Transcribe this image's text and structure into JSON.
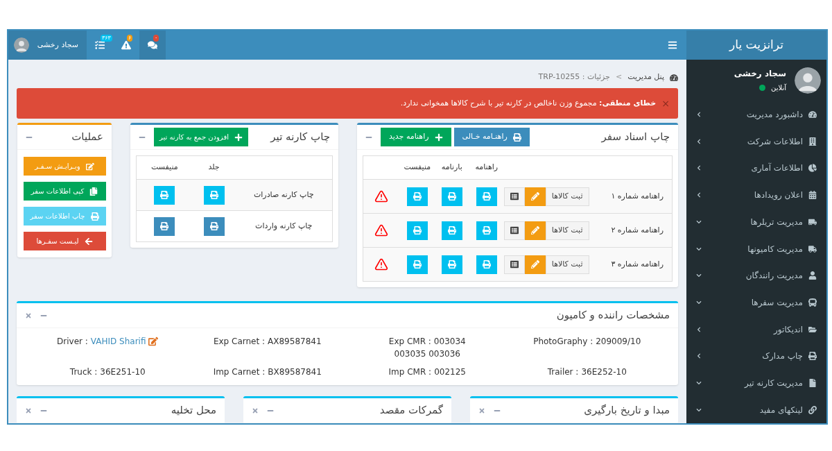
{
  "sidebar": {
    "brand": "ترانزیت یار",
    "user": {
      "name": "سجاد رخشی",
      "status": "آنلاین",
      "online": true
    },
    "items": [
      {
        "label": "داشبورد مدیریت",
        "expanded": false
      },
      {
        "label": "اطلاعات شرکت",
        "expanded": false
      },
      {
        "label": "اطلاعات آماری",
        "expanded": false
      },
      {
        "label": "اعلان رویدادها",
        "expanded": false
      },
      {
        "label": "مدیریت تریلرها",
        "expanded": true
      },
      {
        "label": "مدیریت کامیونها",
        "expanded": true
      },
      {
        "label": "مدیریت رانندگان",
        "expanded": true
      },
      {
        "label": "مدیریت سفرها",
        "expanded": true
      },
      {
        "label": "اندیکاتور",
        "expanded": false
      },
      {
        "label": "چاپ مدارک",
        "expanded": false
      },
      {
        "label": "مدیریت کارنه تیر",
        "expanded": true
      },
      {
        "label": "لینکهای مفید",
        "expanded": true
      }
    ]
  },
  "navbar": {
    "items": [
      {
        "kind": "messages",
        "badge": "۰",
        "color": "#dd4b39",
        "active": true
      },
      {
        "kind": "alerts",
        "badge": "۶",
        "color": "#f39c12",
        "active": false
      },
      {
        "kind": "tasks",
        "badge": "۳۶۳",
        "color": "#00c0ef",
        "active": false
      }
    ],
    "user": {
      "name": "سجاد رخشی",
      "active": true
    }
  },
  "breadcrumb": {
    "items": [
      "پنل مدیریت",
      "جزئیات : TRP-10255"
    ],
    "separator": ">"
  },
  "alert": {
    "close": "×",
    "text": "**خطای منطقی:** مجموع وزن ناخالص در کارنه تیر با شرح کالاها همخوانی ندارد."
  },
  "trip_docs": {
    "title": "چاپ اسناد سفر",
    "color": "#3c8dbc",
    "buttons": [
      {
        "label": "راهنـامه خـالی",
        "kind": "print",
        "color": "#3c8dbc"
      },
      {
        "label": "راهنامه جدید",
        "kind": "add",
        "color": "#00a65a"
      }
    ],
    "columns": [
      "راهنامه",
      "بارنامه",
      "منیفست"
    ],
    "rows": [
      {
        "name": "راهنامه شماره ۱",
        "goods_button": "ثبت کالاها",
        "warning": true
      },
      {
        "name": "راهنامه شماره ۲",
        "goods_button": "ثبت کالاها",
        "warning": true
      },
      {
        "name": "راهنامه شماره ۳",
        "goods_button": "ثبت کالاها",
        "warning": true
      }
    ]
  },
  "carnet": {
    "title": "چاپ کارنه تیر",
    "color": "#3c8dbc",
    "button": "افزودن جمع به کارنه تیر",
    "columns": [
      "جلد",
      "منیفست"
    ],
    "rows": [
      {
        "name": "چاپ کارنه صادرات",
        "color": "#00c0ef"
      },
      {
        "name": "چاپ کارنه واردات",
        "color": "#3c8dbc"
      }
    ]
  },
  "operations": {
    "title": "عملیات",
    "color": "#f39c12",
    "buttons": [
      {
        "label": "ویـرایـش سـفـر",
        "kind": "edit",
        "color": "#f39c12"
      },
      {
        "label": "کپی اطلاعات سفر",
        "kind": "copy",
        "color": "#00a65a"
      },
      {
        "label": "چاپ اطلاعات سفر",
        "kind": "print",
        "color": "#5bd3f2"
      },
      {
        "label": "لیـست سفـرها",
        "kind": "back",
        "color": "#dd4b39"
      }
    ]
  },
  "driver_box": {
    "title": "مشخصات راننده و کامیون",
    "color": "#00c0ef",
    "facts": [
      {
        "label": "PhotoGraphy :",
        "value": "209009/10"
      },
      {
        "label": "Exp CMR :",
        "value": "003034",
        "more": "003035 003036"
      },
      {
        "label": "Exp Carnet :",
        "value": "AX89587841"
      },
      {
        "label": "Driver :",
        "value": "VAHID Sharifi",
        "kind": "link"
      },
      {
        "label": "Trailer :",
        "value": "36E252-10"
      },
      {
        "label": "Imp CMR :",
        "value": "002125"
      },
      {
        "label": "Imp Carnet :",
        "value": "BX89587841"
      },
      {
        "label": "Truck :",
        "value": "36E251-10"
      }
    ]
  },
  "bottom_boxes": [
    {
      "title": "مبدا و تاریخ بارگیری",
      "color": "#00c0ef"
    },
    {
      "title": "گمرکات مقصد",
      "color": "#00c0ef"
    },
    {
      "title": "محل تخلیه",
      "color": "#00c0ef"
    }
  ]
}
